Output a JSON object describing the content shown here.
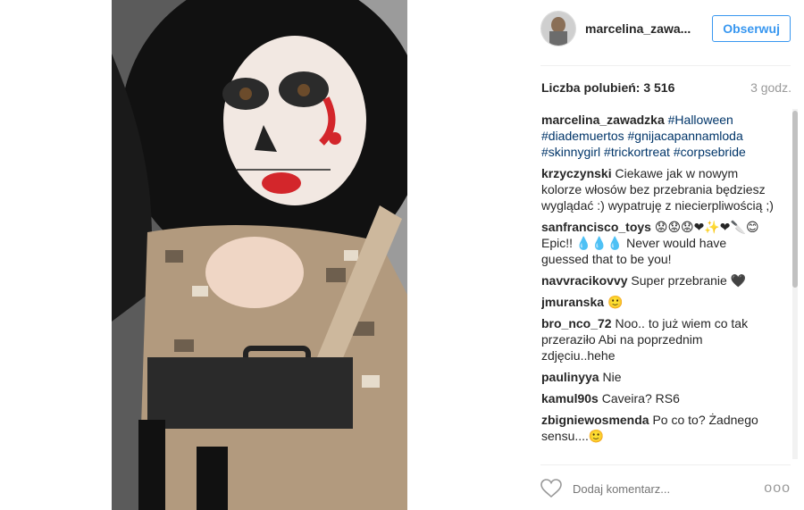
{
  "post": {
    "username": "marcelina_zawa...",
    "follow_label": "Obserwuj",
    "likes_label": "Liczba polubień: 3 516",
    "time": "3 godz."
  },
  "caption": {
    "user": "marcelina_zawadzka",
    "hashtags": [
      "#Halloween",
      "#diademuertos",
      "#gnijacapannamloda",
      "#skinnygirl",
      "#trickortreat",
      "#corpsebride"
    ]
  },
  "comments": [
    {
      "user": "krzyczynski",
      "text": "Ciekawe jak w nowym kolorze włosów bez przebrania będziesz wyglądać :) wypatruję z niecierpliwością ;)"
    },
    {
      "user": "sanfrancisco_toys",
      "text": "😟😟😟❤✨❤🔪😊 Epic!! 💧💧💧 Never would have guessed that to be you!"
    },
    {
      "user": "navvracikovvy",
      "text": "Super przebranie 🖤"
    },
    {
      "user": "jmuranska",
      "text": "🙂"
    },
    {
      "user": "bro_nco_72",
      "text": "Noo.. to już wiem co tak przeraziło Abi na poprzednim zdjęciu..hehe"
    },
    {
      "user": "paulinyya",
      "text": "Nie"
    },
    {
      "user": "kamul90s",
      "text": "Caveira? RS6"
    },
    {
      "user": "zbigniewosmenda",
      "text": "Po co to? Żadnego sensu....🙂"
    }
  ],
  "footer": {
    "comment_placeholder": "Dodaj komentarz...",
    "more_label": "ooo"
  }
}
